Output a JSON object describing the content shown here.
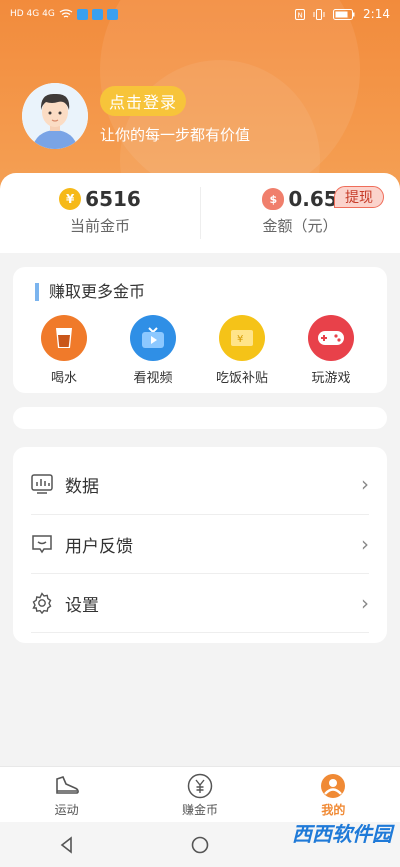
{
  "status_bar": {
    "time": "2:14",
    "left_text": "HD 4G 4G"
  },
  "profile": {
    "login_label": "点击登录",
    "tagline": "让你的每一步都有价值"
  },
  "stats": {
    "coins_value": "6516",
    "coins_label": "当前金币",
    "amount_value": "0.65",
    "amount_label": "金额（元）",
    "withdraw_label": "提现"
  },
  "earn": {
    "title": "赚取更多金币",
    "items": [
      {
        "label": "喝水",
        "icon": "drink-water-icon",
        "color": "#f07a2a"
      },
      {
        "label": "看视频",
        "icon": "video-icon",
        "color": "#2f8fe6"
      },
      {
        "label": "吃饭补贴",
        "icon": "meal-ticket-icon",
        "color": "#f5c318"
      },
      {
        "label": "玩游戏",
        "icon": "gamepad-icon",
        "color": "#e8414a"
      }
    ]
  },
  "menu": [
    {
      "label": "数据",
      "icon": "chart-icon"
    },
    {
      "label": "用户反馈",
      "icon": "feedback-icon"
    },
    {
      "label": "设置",
      "icon": "settings-icon"
    }
  ],
  "tabs": [
    {
      "label": "运动",
      "icon": "sneaker-icon",
      "active": false
    },
    {
      "label": "赚金币",
      "icon": "yen-coin-icon",
      "active": false
    },
    {
      "label": "我的",
      "icon": "profile-icon",
      "active": true
    }
  ],
  "watermark": "西西软件园",
  "colors": {
    "accent": "#f28b3c",
    "active_tab": "#f08a35",
    "login_button": "#f7c43a"
  }
}
